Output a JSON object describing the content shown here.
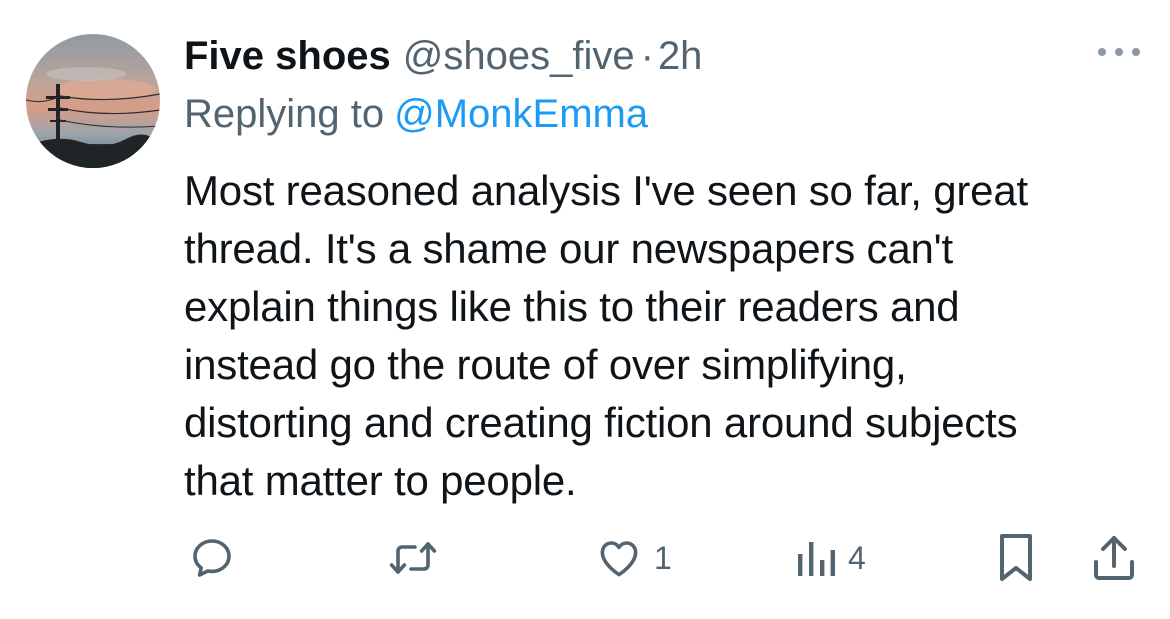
{
  "tweet": {
    "display_name": "Five shoes",
    "handle": "@shoes_five",
    "separator": "·",
    "time": "2h",
    "replying_prefix": "Replying to",
    "replying_target": "@MonkEmma",
    "text_lines": [
      "Most reasoned analysis I've seen so far, great",
      "thread. It's a shame our newspapers can't",
      "explain things like this to their readers and",
      "instead go the route of over simplifying,",
      "distorting and creating fiction around subjects",
      "that matter to people."
    ]
  },
  "actions": {
    "reply": {
      "icon": "reply-icon"
    },
    "retweet": {
      "icon": "retweet-icon"
    },
    "like": {
      "icon": "heart-icon",
      "count": "1"
    },
    "views": {
      "icon": "views-chart-icon",
      "count": "4"
    },
    "bookmark": {
      "icon": "bookmark-icon"
    },
    "share": {
      "icon": "share-icon"
    }
  },
  "colors": {
    "text": "#0f1419",
    "secondary": "#536471",
    "link": "#1d9bf0"
  }
}
